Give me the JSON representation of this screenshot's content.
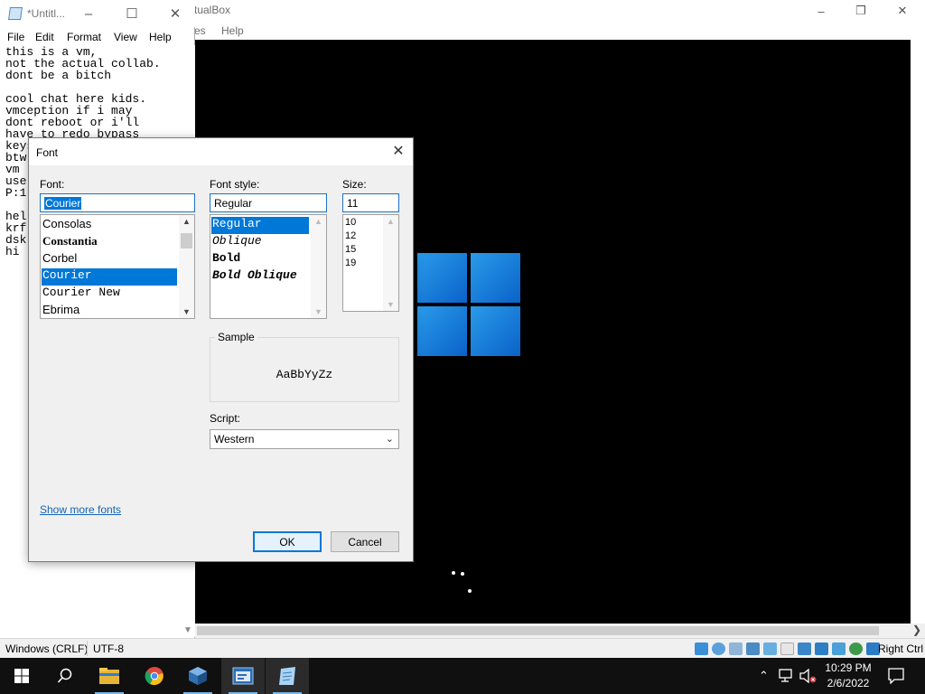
{
  "vbox": {
    "title": "tualBox",
    "menu": [
      "es",
      "Help"
    ],
    "host_key": "Right Ctrl"
  },
  "notepad": {
    "title": "*Untitl...",
    "menu": [
      "File",
      "Edit",
      "Format",
      "View",
      "Help"
    ],
    "text": "this is a vm,\nnot the actual collab.\ndont be a bitch\n\ncool chat here kids.\nvmception if i may\ndont reboot or i'll\nhave to redo bypass\nkeys\nbtw\nvm\nuse\nP:1\n\nhel\nkrf\ndsk\nhi",
    "line_ending": "Windows (CRLF)",
    "encoding": "UTF-8"
  },
  "font_dialog": {
    "title": "Font",
    "font_label": "Font:",
    "font_value": "Courier",
    "fonts": [
      "Consolas",
      "Constantia",
      "Corbel",
      "Courier",
      "Courier New",
      "Ebrima"
    ],
    "selected_font": "Courier",
    "style_label": "Font style:",
    "style_value": "Regular",
    "styles": [
      "Regular",
      "Oblique",
      "Bold",
      "Bold Oblique"
    ],
    "selected_style": "Regular",
    "size_label": "Size:",
    "size_value": "11",
    "sizes": [
      "10",
      "12",
      "15",
      "19"
    ],
    "sample_label": "Sample",
    "sample_text": "AaBbYyZz",
    "script_label": "Script:",
    "script_value": "Western",
    "show_more_fonts": "Show more fonts",
    "ok_label": "OK",
    "cancel_label": "Cancel"
  },
  "taskbar": {
    "time": "10:29 PM",
    "date": "2/6/2022"
  },
  "colors": {
    "accent": "#0078d7",
    "windows_logo": "#0a62c9"
  }
}
